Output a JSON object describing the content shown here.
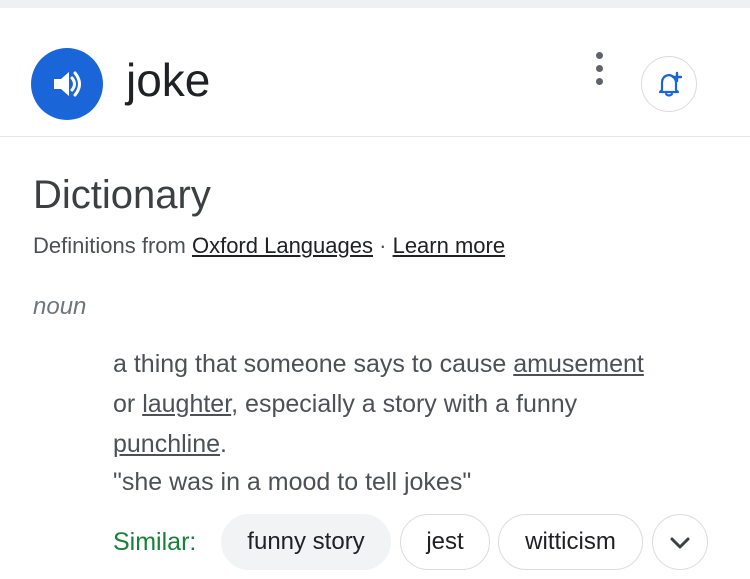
{
  "header": {
    "word": "joke",
    "pronounce_icon": "speaker-icon",
    "menu_icon": "more-vert-icon",
    "alert_icon": "add-alert-bell-icon"
  },
  "dictionary": {
    "title": "Dictionary",
    "sources_prefix": "Definitions from",
    "source_link": "Oxford Languages",
    "separator": "·",
    "learn_more": "Learn more"
  },
  "entry": {
    "part_of_speech": "noun",
    "definition": {
      "t1": "a thing that someone says to cause ",
      "link1": "amusement",
      "t2": "or ",
      "link2": "laughter",
      "t3": ", especially a story with a funny ",
      "link3": "punchline",
      "t4": "."
    },
    "example": "\"she was in a mood to tell jokes\"",
    "similar_label": "Similar:",
    "similar": [
      "funny story",
      "jest",
      "witticism"
    ],
    "expand_icon": "chevron-down-icon"
  },
  "colors": {
    "accent_blue": "#1a66d8",
    "similar_green": "#188038"
  }
}
